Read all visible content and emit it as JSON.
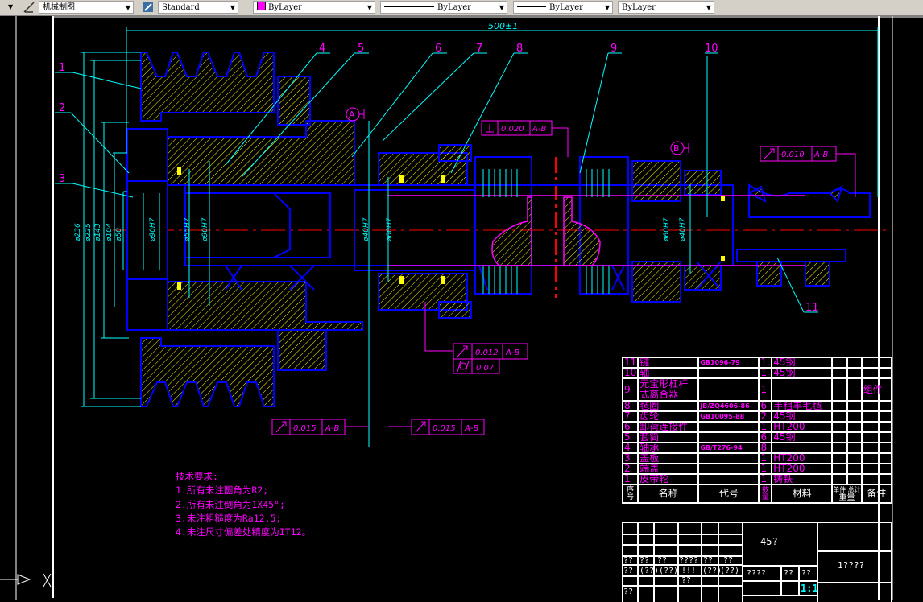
{
  "toolbar": {
    "text_style": "机械制图",
    "dim_style": "Standard",
    "color": "ByLayer",
    "color_swatch": "#ff00ff",
    "linetype": "ByLayer",
    "lineweight": "ByLayer",
    "plot_style": "ByLayer"
  },
  "drawing": {
    "overall_dim": "500±1",
    "part_labels": [
      "1",
      "2",
      "3",
      "4",
      "5",
      "6",
      "7",
      "8",
      "9",
      "10",
      "11"
    ],
    "datums": [
      "A",
      "B"
    ],
    "diameters": [
      "ø236",
      "ø225",
      "ø143",
      "ø104",
      "ø50",
      "ø90H7",
      "ø55H7",
      "ø90H7",
      "ø40H7",
      "ø60H7",
      "ø60H7",
      "ø40H7"
    ],
    "tolerances": [
      {
        "symbol": "perpendicularity",
        "value": "0.020",
        "datum": "A-B"
      },
      {
        "symbol": "circular-runout",
        "value": "0.010",
        "datum": "A-B"
      },
      {
        "symbol": "circular-runout",
        "value": "0.012",
        "datum": "A-B"
      },
      {
        "symbol": "cylindricity",
        "value": "0.07",
        "datum": ""
      },
      {
        "symbol": "circular-runout",
        "value": "0.015",
        "datum": "A-B"
      },
      {
        "symbol": "circular-runout",
        "value": "0.015",
        "datum": "A-B"
      }
    ],
    "colors": {
      "outline": "#0000ff",
      "hatch": "#ffff00",
      "dim": "#00ffff",
      "center": "#ff0000",
      "text": "#ff00ff"
    }
  },
  "notes": {
    "title": "技术要求:",
    "items": [
      "1.所有未注圆角为R2;",
      "2.所有未注倒角为1X45°;",
      "3.未注粗糙度为Ra12.5;",
      "4.未注尺寸偏差处精度为IT12。"
    ]
  },
  "bom": {
    "rows": [
      {
        "no": "11",
        "name": "键",
        "code": "GB1096-79",
        "qty": "1",
        "material": "45钢",
        "note": ""
      },
      {
        "no": "10",
        "name": "轴",
        "code": "",
        "qty": "1",
        "material": "45钢",
        "note": ""
      },
      {
        "no": "9",
        "name": "元宝形杠杆式离合器",
        "code": "",
        "qty": "1",
        "material": "",
        "note": "组件"
      },
      {
        "no": "8",
        "name": "毡圈",
        "code": "JB/ZQ4606-86",
        "qty": "6",
        "material": "半粗羊毛毡",
        "note": ""
      },
      {
        "no": "7",
        "name": "齿轮",
        "code": "GB10095-88",
        "qty": "2",
        "material": "45钢",
        "note": ""
      },
      {
        "no": "6",
        "name": "卸荷连接件",
        "code": "",
        "qty": "1",
        "material": "HT200",
        "note": ""
      },
      {
        "no": "5",
        "name": "套筒",
        "code": "",
        "qty": "6",
        "material": "45钢",
        "note": ""
      },
      {
        "no": "4",
        "name": "轴承",
        "code": "GB/T276-94",
        "qty": "8",
        "material": "",
        "note": ""
      },
      {
        "no": "3",
        "name": "盖板",
        "code": "",
        "qty": "1",
        "material": "HT200",
        "note": ""
      },
      {
        "no": "2",
        "name": "端盖",
        "code": "",
        "qty": "1",
        "material": "HT200",
        "note": ""
      },
      {
        "no": "1",
        "name": "皮带轮",
        "code": "",
        "qty": "1",
        "material": "铸铁",
        "note": ""
      }
    ],
    "headers": {
      "no": "序号",
      "name": "名称",
      "code": "代号",
      "qty": "数量",
      "material": "材料",
      "single": "单件",
      "total": "总计",
      "weight": "重量",
      "note": "备注"
    }
  },
  "title_block": {
    "material": "45?",
    "drawing_name": "1????",
    "scale": "1:1",
    "garbled": [
      "??",
      "??",
      "??",
      "????",
      "??",
      "??",
      "??",
      "(??)",
      "(??)",
      "!!!",
      "(??)",
      "(??)",
      "??",
      "??",
      "????",
      "??",
      "??"
    ]
  }
}
